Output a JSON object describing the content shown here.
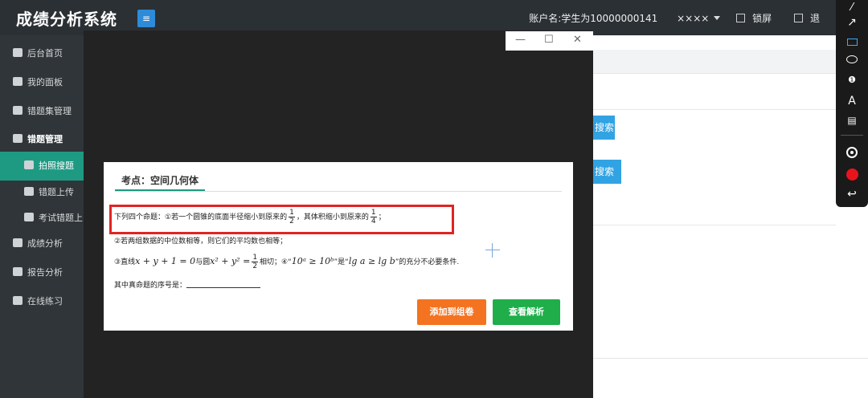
{
  "header": {
    "title": "成绩分析系统",
    "menu_icon": "≡",
    "account_label": "账户名:学生为10000000141",
    "masked_name": "××××",
    "lock_label": "锁屏",
    "logout_label": "退"
  },
  "sidebar": {
    "items": [
      {
        "label": "后台首页"
      },
      {
        "label": "我的面板"
      },
      {
        "label": "错题集管理"
      },
      {
        "label": "错题管理"
      },
      {
        "label": "拍照搜题"
      },
      {
        "label": "错题上传"
      },
      {
        "label": "考试错题上"
      },
      {
        "label": "成绩分析"
      },
      {
        "label": "报告分析"
      },
      {
        "label": "在线练习"
      }
    ]
  },
  "background": {
    "search_button_1": "搜索",
    "search_button_2": "搜索"
  },
  "window": {
    "minimize": "—",
    "maximize": "☐",
    "close": "✕"
  },
  "question": {
    "tab_label": "考点：空间几何体",
    "line1_a": "下列四个命题：①若一个圆锥的底面半径缩小到原来的",
    "line1_b": "，其体积缩小到原来的",
    "line1_c": "；",
    "frac1_num": "1",
    "frac1_den": "2",
    "frac2_num": "1",
    "frac2_den": "4",
    "line2": "②若两组数据的中位数相等，则它们的平均数也相等；",
    "line3_a": "③直线",
    "line3_expr1": "x + y + 1 = 0",
    "line3_b": "与圆",
    "line3_expr2": "x² + y² =",
    "frac3_num": "1",
    "frac3_den": "2",
    "line3_c": "相切；④“",
    "line3_expr3": "10ᵃ ≥ 10ᵇ",
    "line3_d": "”是“",
    "line3_expr4": "lg a ≥ lg b",
    "line3_e": "”的充分不必要条件.",
    "line4": "其中真命题的序号是：",
    "add_button": "添加到组卷",
    "view_button": "查看解析"
  },
  "toolbar": {
    "tools": [
      "pen-icon",
      "arrow-icon",
      "rectangle-icon",
      "ellipse-icon",
      "numbered-marker-icon",
      "text-icon",
      "screen-icon",
      "record-ring-icon",
      "red-dot-icon",
      "undo-icon"
    ],
    "text_tool": "A"
  }
}
